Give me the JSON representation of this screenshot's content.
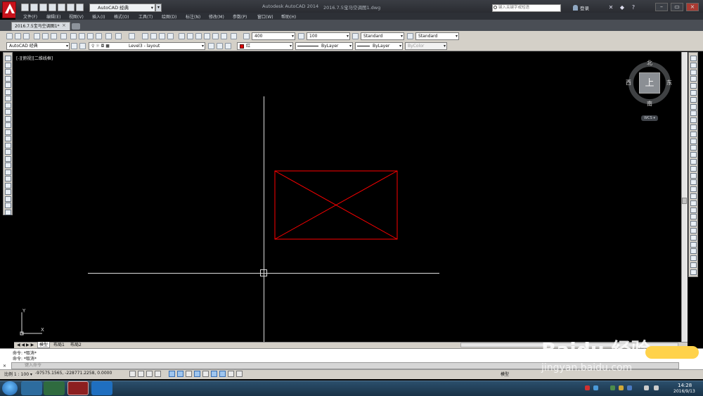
{
  "title_bar": {
    "workspace": "AutoCAD 经典",
    "app_title": "Autodesk AutoCAD 2014",
    "doc_title": "2016.7.5宝马空调图1.dwg",
    "search_placeholder": "键入关键字或短语",
    "login": "登录",
    "minimize": "–",
    "restore": "▭",
    "close": "×"
  },
  "menu": [
    "文件(F)",
    "编辑(E)",
    "视图(V)",
    "插入(I)",
    "格式(O)",
    "工具(T)",
    "绘图(D)",
    "标注(N)",
    "修改(M)",
    "参数(P)",
    "窗口(W)",
    "帮助(H)"
  ],
  "tab": {
    "label": "2016.7.5宝马空调图1*",
    "close": "×"
  },
  "toolbar": {
    "text_height": "400",
    "dim_value": "100",
    "text_style": "Standard",
    "dim_style": "Standard",
    "workspace_combo": "AutoCAD 经典",
    "layer": "Level3 - layout",
    "color": "红",
    "linetype": "ByLayer",
    "lineweight": "ByLayer",
    "plotstyle": "ByColor"
  },
  "viewport": {
    "label": "[-][俯视][二维线框]"
  },
  "viewcube": {
    "face": "上",
    "north": "北",
    "south": "南",
    "east": "东",
    "west": "西",
    "wcs": "WCS ▾"
  },
  "ucs": {
    "x": "X",
    "y": "Y"
  },
  "layout_tabs": {
    "nav": "◀ ◀ ▶ ▶",
    "model": "模型",
    "layout1": "布局1",
    "layout2": "布局2"
  },
  "command": {
    "history": [
      "命令: *取消*",
      "命令: *取消*"
    ],
    "prompt": "键入命令"
  },
  "status": {
    "scale": "比例 1 : 100 ▾",
    "coords": "-97575.1565, -228771.2258, 0.0000",
    "model": "模型"
  },
  "taskbar": {
    "time": "14:28",
    "date": "2016/9/13"
  },
  "watermark": {
    "brand": "Baidu 经验",
    "url": "jingyan.baidu.com"
  },
  "colors": {
    "entity_red": "#ff0000",
    "background": "#000000",
    "crosshair": "#dddddd"
  }
}
